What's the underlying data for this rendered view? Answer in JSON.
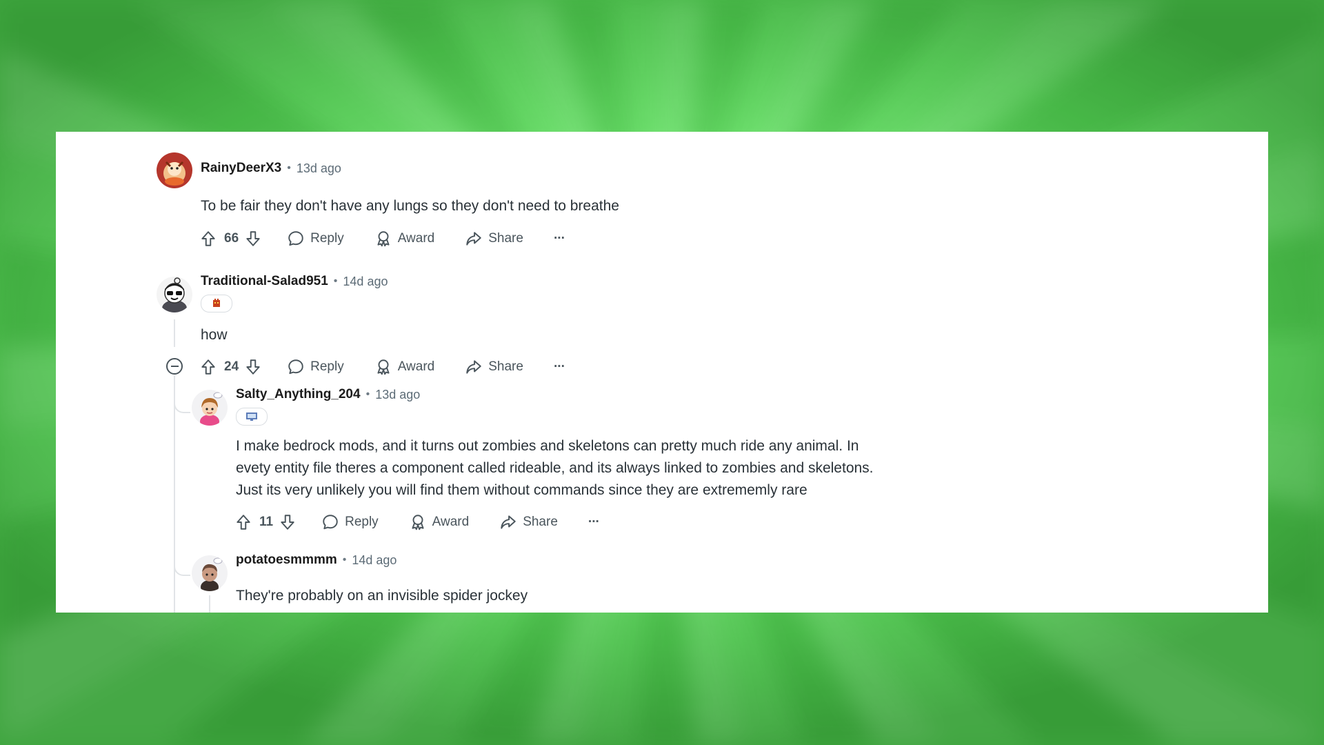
{
  "comments": [
    {
      "username": "RainyDeerX3",
      "time": "13d ago",
      "body": [
        "To be fair they don't have any lungs so they don't need to breathe"
      ],
      "votes": "66",
      "reply_label": "Reply",
      "award_label": "Award",
      "share_label": "Share",
      "more_label": "···"
    },
    {
      "username": "Traditional-Salad951",
      "time": "14d ago",
      "body": [
        "how"
      ],
      "votes": "24",
      "reply_label": "Reply",
      "award_label": "Award",
      "share_label": "Share",
      "more_label": "···"
    },
    {
      "username": "Salty_Anything_204",
      "time": "13d ago",
      "body": [
        "I make bedrock mods, and it turns out zombies and skeletons can pretty much ride any animal. In",
        "evety entity file theres a component called rideable, and its always linked to zombies and skeletons.",
        "Just its very unlikely you will find them without commands since they are extrememly rare"
      ],
      "votes": "11",
      "reply_label": "Reply",
      "award_label": "Award",
      "share_label": "Share",
      "more_label": "···"
    },
    {
      "username": "potatoesmmmm",
      "time": "14d ago",
      "body": [
        "They're probably on an invisible spider jockey"
      ]
    }
  ],
  "separator": "•",
  "icons": {
    "upvote": "arrow-up-icon",
    "downvote": "arrow-down-icon",
    "reply": "speech-bubble-icon",
    "award": "award-ribbon-icon",
    "share": "share-arrow-icon",
    "more": "more-dots-icon",
    "collapse": "collapse-minus-icon"
  },
  "colors": {
    "background": "#6ee66e",
    "card": "#ffffff",
    "username": "#1c1c1c",
    "meta": "#5c6b76",
    "text": "#2a3238",
    "actions": "#4a555c"
  }
}
